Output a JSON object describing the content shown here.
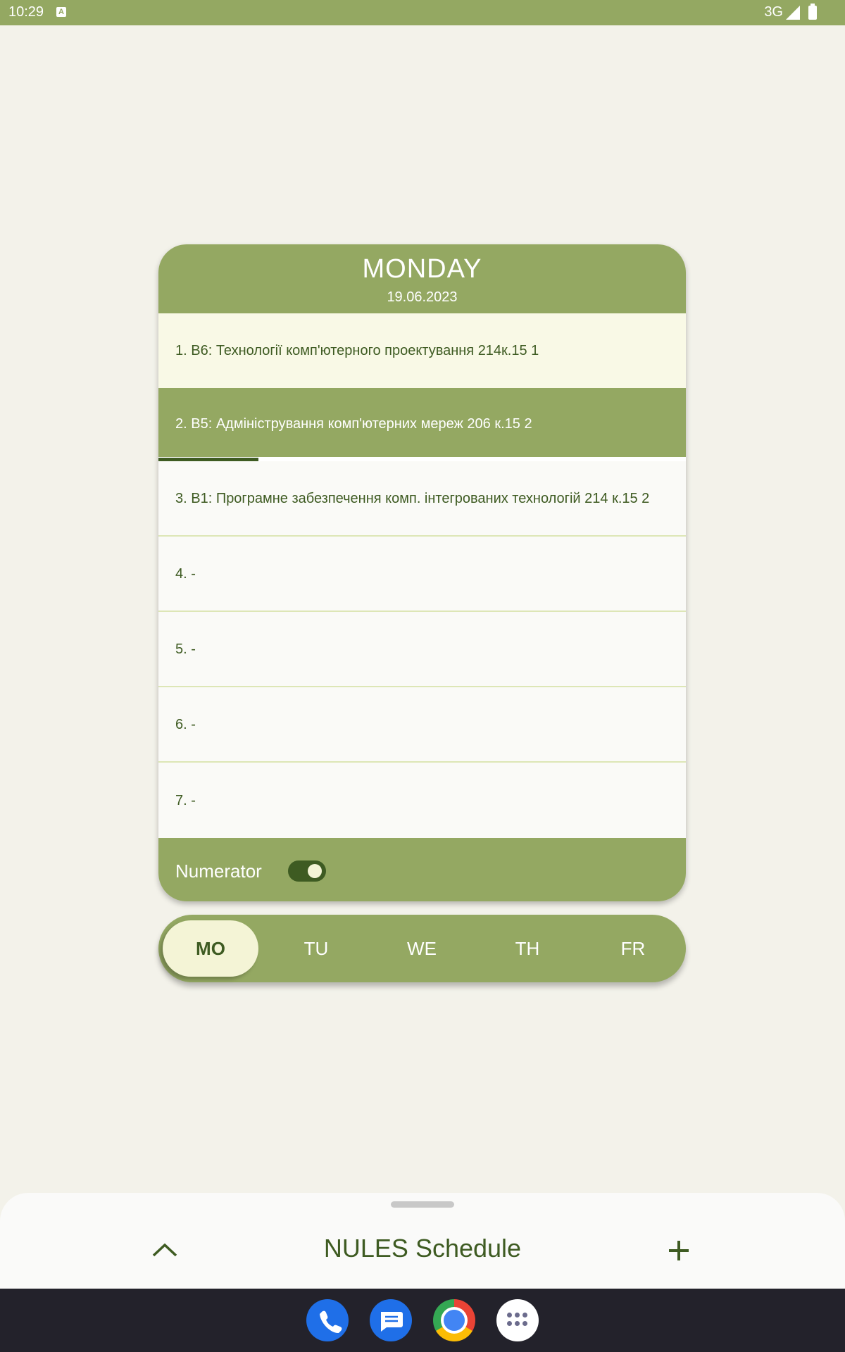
{
  "status_bar": {
    "time": "10:29",
    "network": "3G"
  },
  "day_card": {
    "day_name": "MONDAY",
    "date": "19.06.2023",
    "lessons": [
      {
        "label": "1. В6: Технології комп'ютерного проектування 214к.15 1",
        "state": "past"
      },
      {
        "label": "2. В5: Адміністрування комп'ютерних мереж 206 к.15 2",
        "state": "current"
      },
      {
        "label": "3. В1: Програмне забезпечення комп. інтегрованих технологій 214 к.15 2",
        "state": "upcoming"
      },
      {
        "label": "4. -",
        "state": "upcoming"
      },
      {
        "label": "5. -",
        "state": "upcoming"
      },
      {
        "label": "6. -",
        "state": "upcoming"
      },
      {
        "label": "7. -",
        "state": "upcoming"
      }
    ],
    "current_lesson_progress": 0.19,
    "numerator_label": "Numerator",
    "numerator_enabled": true
  },
  "day_selector": {
    "days": [
      "MO",
      "TU",
      "WE",
      "TH",
      "FR"
    ],
    "selected": "MO"
  },
  "bottom_sheet": {
    "title": "NULES Schedule"
  },
  "icons": {
    "expand": "chevron-up-icon",
    "add": "plus-icon",
    "dock": [
      "phone-icon",
      "messages-icon",
      "chrome-icon",
      "app-drawer-icon"
    ]
  },
  "colors": {
    "primary": "#94a862",
    "dark_green": "#3e5b22",
    "active_tab": "#f4f4d6",
    "background": "#f3f2ea"
  }
}
